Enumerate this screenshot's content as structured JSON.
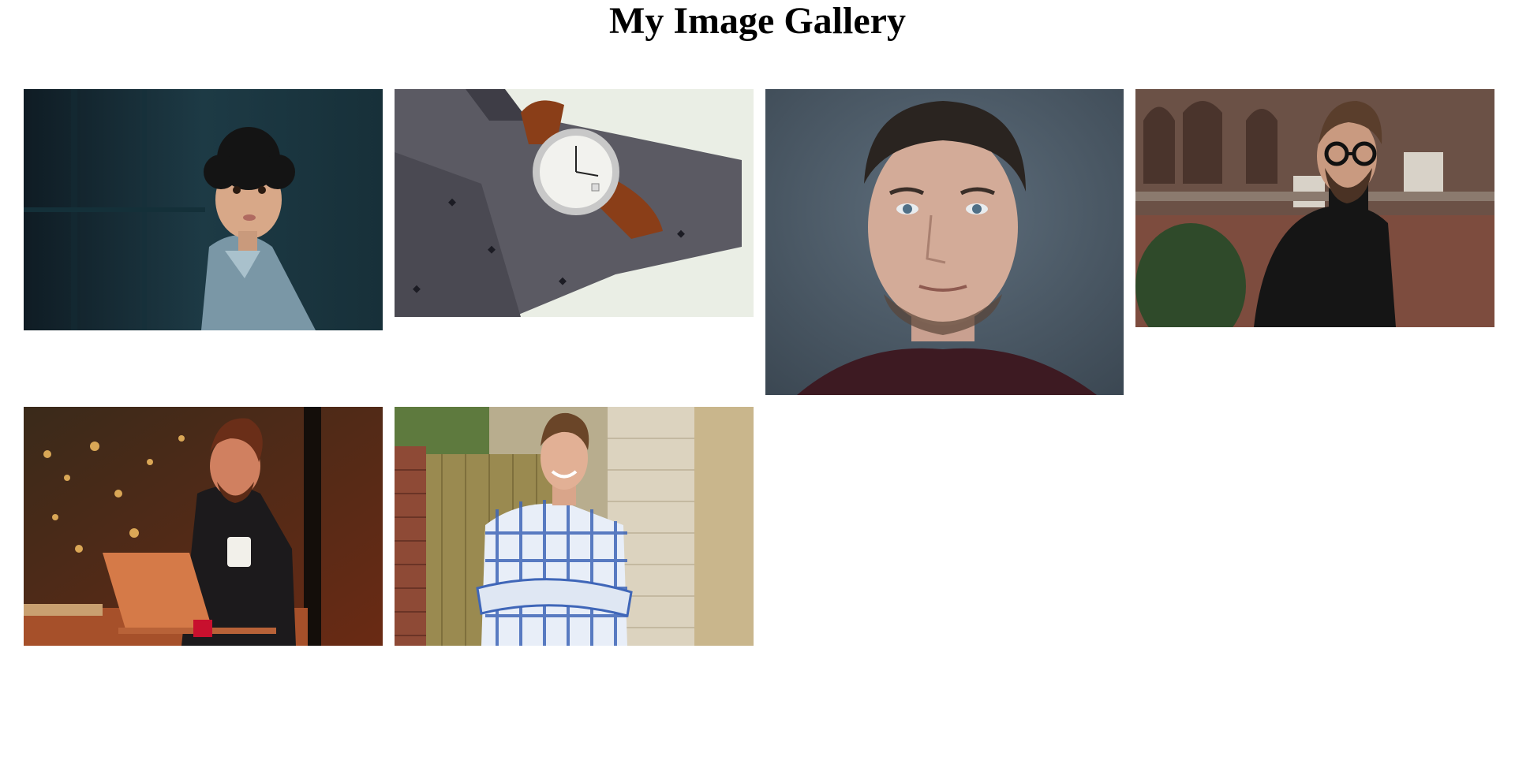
{
  "page": {
    "title": "My Image Gallery"
  },
  "gallery": {
    "images": [
      {
        "name": "curly-haired-child-photo"
      },
      {
        "name": "wristwatch-on-tie-photo"
      },
      {
        "name": "man-portrait-photo"
      },
      {
        "name": "man-with-glasses-turtleneck-photo"
      },
      {
        "name": "man-with-laptop-and-mug-photo"
      },
      {
        "name": "young-man-plaid-shirt-photo"
      }
    ]
  }
}
